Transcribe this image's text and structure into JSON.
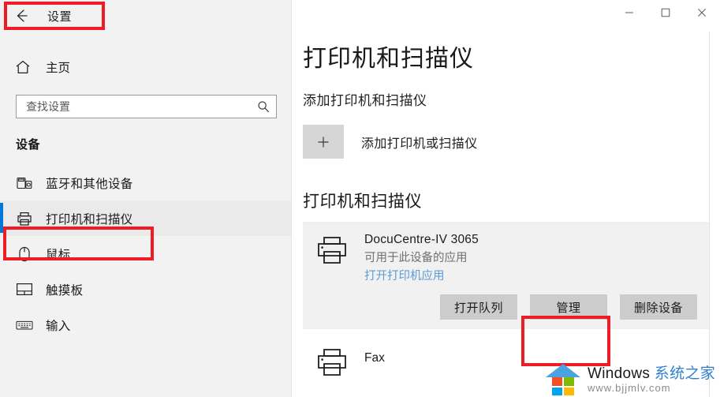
{
  "sidebar": {
    "back_icon": "back-arrow-icon",
    "app_title": "设置",
    "home": {
      "icon": "home-icon",
      "label": "主页"
    },
    "search": {
      "icon": "search-icon",
      "placeholder": "查找设置",
      "value": ""
    },
    "section_title": "设备",
    "items": [
      {
        "icon": "bluetooth-devices-icon",
        "label": "蓝牙和其他设备",
        "selected": false
      },
      {
        "icon": "printer-icon",
        "label": "打印机和扫描仪",
        "selected": true
      },
      {
        "icon": "mouse-icon",
        "label": "鼠标",
        "selected": false
      },
      {
        "icon": "touchpad-icon",
        "label": "触摸板",
        "selected": false
      },
      {
        "icon": "keyboard-icon",
        "label": "输入",
        "selected": false
      }
    ]
  },
  "titlebar": {
    "minimize_icon": "minimize-icon",
    "maximize_icon": "maximize-icon",
    "close_icon": "close-icon"
  },
  "main": {
    "page_title": "打印机和扫描仪",
    "add_section_title": "添加打印机和扫描仪",
    "add_button": {
      "icon": "plus-icon",
      "label": "添加打印机或扫描仪"
    },
    "list_section_title": "打印机和扫描仪",
    "devices": [
      {
        "icon": "printer-icon",
        "name": "DocuCentre-IV 3065",
        "status": "可用于此设备的应用",
        "link": "打开打印机应用",
        "expanded": true,
        "actions": [
          {
            "label": "打开队列",
            "highlighted": false
          },
          {
            "label": "管理",
            "highlighted": true
          },
          {
            "label": "删除设备",
            "highlighted": false
          }
        ]
      },
      {
        "icon": "printer-icon",
        "name": "Fax",
        "status": "",
        "link": "",
        "expanded": false,
        "actions": []
      }
    ]
  },
  "annotations": {
    "color": "#ee1c25",
    "boxes": [
      {
        "target": "settings-title"
      },
      {
        "target": "sidebar-item-printers"
      },
      {
        "target": "manage-button"
      }
    ]
  },
  "watermark": {
    "brand_en": "Windows ",
    "brand_cn": "系统之家",
    "url": "www.bjjmlv.com"
  }
}
